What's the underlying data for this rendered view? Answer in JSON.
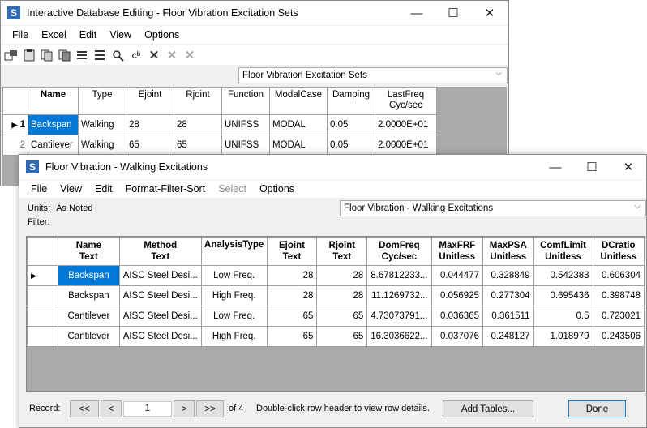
{
  "back_window": {
    "title": "Interactive Database Editing - Floor Vibration Excitation Sets",
    "app_icon_letter": "S",
    "menu": [
      "File",
      "Excel",
      "Edit",
      "View",
      "Options"
    ],
    "table_select": "Floor Vibration Excitation Sets",
    "headers": [
      "Name",
      "Type",
      "Ejoint",
      "Rjoint",
      "Function",
      "ModalCase",
      "Damping",
      "LastFreq\nCyc/sec"
    ],
    "rows": [
      {
        "num": "1",
        "cells": [
          "Backspan",
          "Walking",
          "28",
          "28",
          "UNIFSS",
          "MODAL",
          "0.05",
          "2.0000E+01"
        ]
      },
      {
        "num": "2",
        "cells": [
          "Cantilever",
          "Walking",
          "65",
          "65",
          "UNIFSS",
          "MODAL",
          "0.05",
          "2.0000E+01"
        ]
      }
    ]
  },
  "front_window": {
    "title": "Floor Vibration - Walking Excitations",
    "app_icon_letter": "S",
    "menu": [
      "File",
      "View",
      "Edit",
      "Format-Filter-Sort",
      "Select",
      "Options"
    ],
    "units_label": "Units:",
    "units_value": "As Noted",
    "filter_label": "Filter:",
    "table_select": "Floor Vibration - Walking Excitations",
    "headers": [
      {
        "l1": "Name",
        "l2": "Text"
      },
      {
        "l1": "Method",
        "l2": "Text"
      },
      {
        "l1": "AnalysisType",
        "l2": ""
      },
      {
        "l1": "Ejoint",
        "l2": "Text"
      },
      {
        "l1": "Rjoint",
        "l2": "Text"
      },
      {
        "l1": "DomFreq",
        "l2": "Cyc/sec"
      },
      {
        "l1": "MaxFRF",
        "l2": "Unitless"
      },
      {
        "l1": "MaxPSA",
        "l2": "Unitless"
      },
      {
        "l1": "ComfLimit",
        "l2": "Unitless"
      },
      {
        "l1": "DCratio",
        "l2": "Unitless"
      }
    ],
    "rows": [
      [
        "Backspan",
        "AISC Steel Desi...",
        "Low Freq.",
        "28",
        "28",
        "8.67812233...",
        "0.044477",
        "0.328849",
        "0.542383",
        "0.606304"
      ],
      [
        "Backspan",
        "AISC Steel Desi...",
        "High Freq.",
        "28",
        "28",
        "11.1269732...",
        "0.056925",
        "0.277304",
        "0.695436",
        "0.398748"
      ],
      [
        "Cantilever",
        "AISC Steel Desi...",
        "Low Freq.",
        "65",
        "65",
        "4.73073791...",
        "0.036365",
        "0.361511",
        "0.5",
        "0.723021"
      ],
      [
        "Cantilever",
        "AISC Steel Desi...",
        "High Freq.",
        "65",
        "65",
        "16.3036622...",
        "0.037076",
        "0.248127",
        "1.018979",
        "0.243506"
      ]
    ],
    "record_label": "Record:",
    "nav_first": "<<",
    "nav_prev": "<",
    "record_value": "1",
    "nav_next": ">",
    "nav_last": ">>",
    "of_text": "of 4",
    "hint": "Double-click row header to view row details.",
    "add_tables": "Add Tables...",
    "done": "Done"
  },
  "colors": {
    "selection": "#0078d7",
    "icon_blue": "#2e6bb3",
    "gray_area": "#ababab"
  }
}
